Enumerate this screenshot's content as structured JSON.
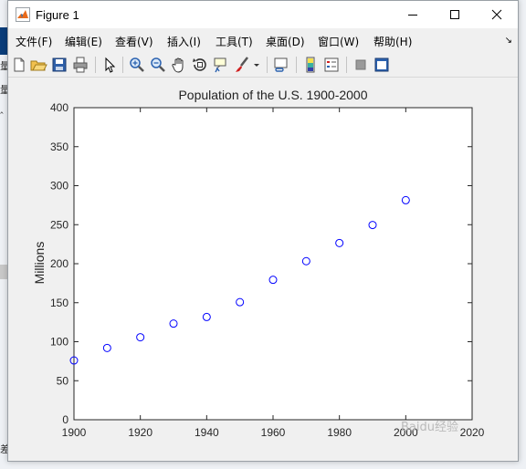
{
  "window": {
    "title": "Figure 1"
  },
  "menu": [
    {
      "label": "文件(F)"
    },
    {
      "label": "编辑(E)"
    },
    {
      "label": "查看(V)"
    },
    {
      "label": "插入(I)"
    },
    {
      "label": "工具(T)"
    },
    {
      "label": "桌面(D)"
    },
    {
      "label": "窗口(W)"
    },
    {
      "label": "帮助(H)"
    }
  ],
  "toolbar": [
    {
      "icon": "new-figure-icon"
    },
    {
      "icon": "open-file-icon"
    },
    {
      "icon": "save-icon"
    },
    {
      "icon": "print-icon"
    },
    {
      "icon": "pointer-icon"
    },
    {
      "icon": "zoom-in-icon"
    },
    {
      "icon": "zoom-out-icon"
    },
    {
      "icon": "pan-icon"
    },
    {
      "icon": "rotate-3d-icon"
    },
    {
      "icon": "data-cursor-icon"
    },
    {
      "icon": "brush-icon"
    },
    {
      "icon": "link-plot-icon"
    },
    {
      "icon": "colorbar-icon"
    },
    {
      "icon": "legend-icon"
    },
    {
      "icon": "hide-plot-tools-icon"
    },
    {
      "icon": "show-plot-tools-icon"
    }
  ],
  "background_glyphs": [
    "量",
    "量",
    "‸",
    "差"
  ],
  "watermark": "Baidu经验",
  "chart_data": {
    "type": "scatter",
    "title": "Population of the U.S. 1900-2000",
    "xlabel": "",
    "ylabel": "Millions",
    "xlim": [
      1900,
      2020
    ],
    "ylim": [
      0,
      400
    ],
    "xticks": [
      1900,
      1920,
      1940,
      1960,
      1980,
      2000,
      2020
    ],
    "yticks": [
      0,
      50,
      100,
      150,
      200,
      250,
      300,
      350,
      400
    ],
    "x": [
      1900,
      1910,
      1920,
      1930,
      1940,
      1950,
      1960,
      1970,
      1980,
      1990,
      2000
    ],
    "y": [
      75.995,
      91.972,
      105.711,
      123.203,
      131.669,
      150.697,
      179.323,
      203.212,
      226.505,
      249.633,
      281.422
    ],
    "marker": "circle-open",
    "color": "#0000ff",
    "grid": false
  }
}
